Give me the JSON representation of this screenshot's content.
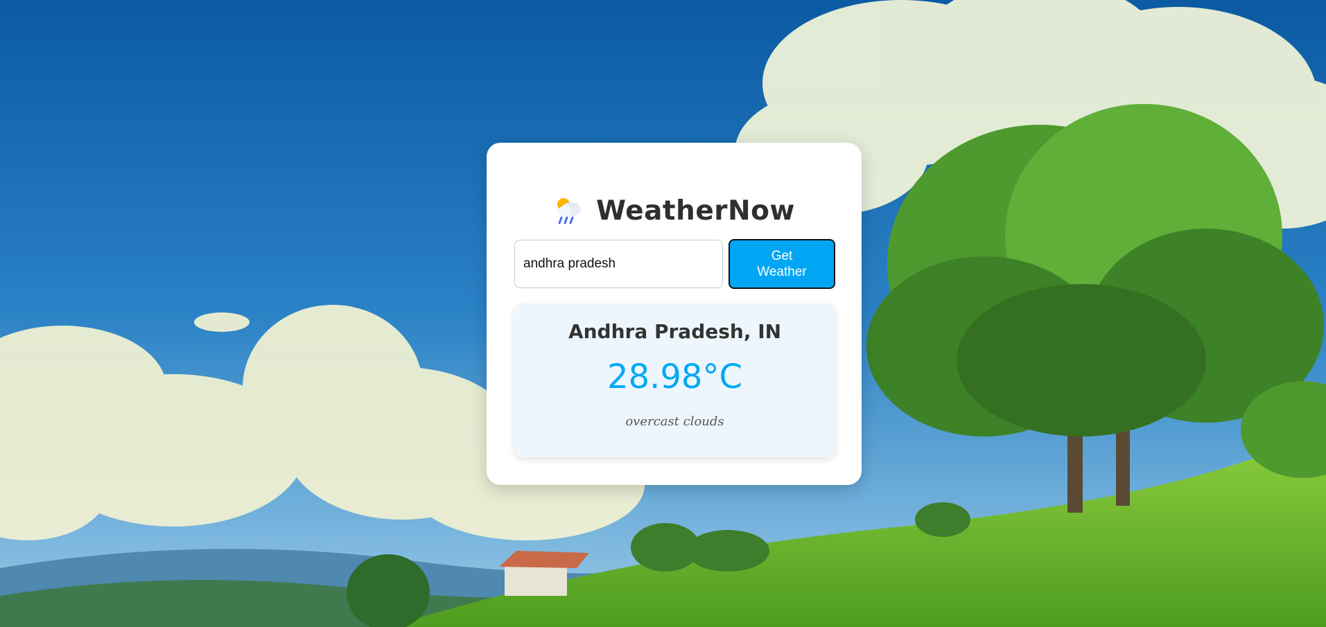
{
  "app": {
    "title": "WeatherNow",
    "title_icon": "sun-behind-rain-cloud-icon"
  },
  "search": {
    "value": "andhra pradesh",
    "placeholder": "",
    "button_label": "Get Weather"
  },
  "result": {
    "location": "Andhra Pradesh, IN",
    "temperature": "28.98°C",
    "description": "overcast clouds"
  },
  "colors": {
    "accent": "#00a6f4",
    "temperature": "#03a9f4",
    "card_bg": "#ffffff",
    "result_bg": "#eef6fd",
    "title_text": "#2f2f2f"
  }
}
